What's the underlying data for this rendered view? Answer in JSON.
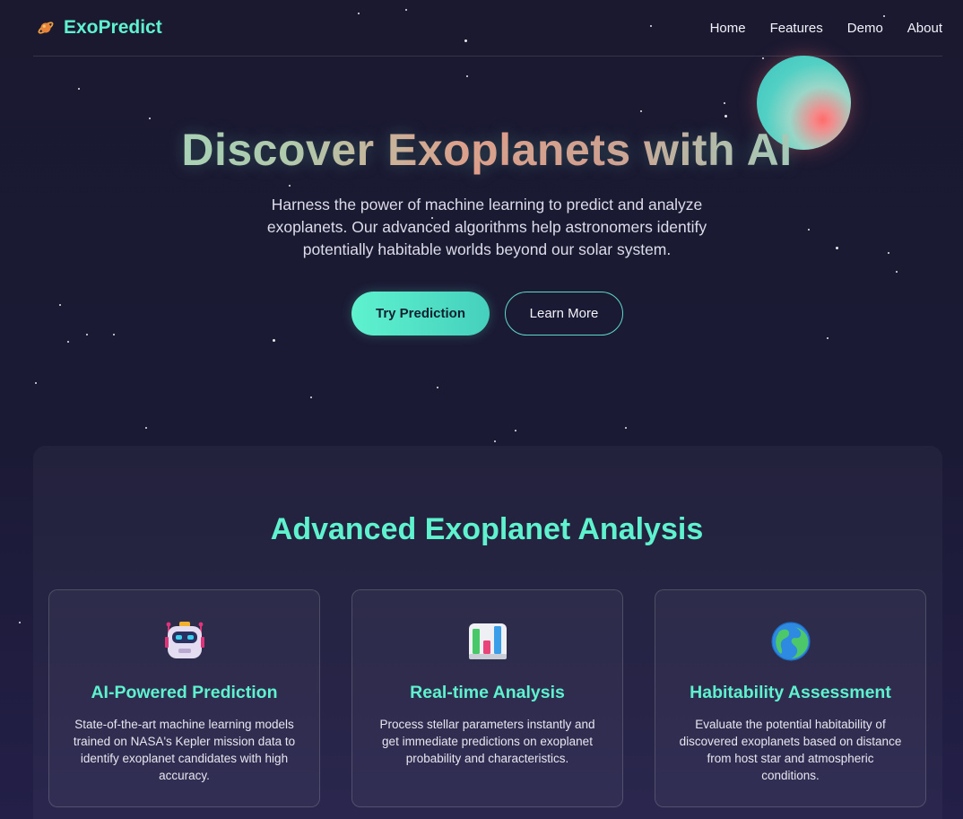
{
  "nav": {
    "brand": "ExoPredict",
    "brand_icon": "planet-rocket-icon",
    "links": [
      "Home",
      "Features",
      "Demo",
      "About"
    ]
  },
  "hero": {
    "title": "Discover Exoplanets with AI",
    "subtitle": "Harness the power of machine learning to predict and analyze exoplanets. Our advanced algorithms help astronomers identify potentially habitable worlds beyond our solar system.",
    "primary_button": "Try Prediction",
    "secondary_button": "Learn More"
  },
  "features": {
    "title": "Advanced Exoplanet Analysis",
    "cards": [
      {
        "icon": "robot-icon",
        "title": "AI-Powered Prediction",
        "text": "State-of-the-art machine learning models trained on NASA's Kepler mission data to identify exoplanet candidates with high accuracy."
      },
      {
        "icon": "bar-chart-icon",
        "title": "Real-time Analysis",
        "text": "Process stellar parameters instantly and get immediate predictions on exoplanet probability and characteristics."
      },
      {
        "icon": "globe-icon",
        "title": "Habitability Assessment",
        "text": "Evaluate the potential habitability of discovered exoplanets based on distance from host star and atmospheric conditions."
      }
    ]
  },
  "colors": {
    "accent": "#5ef2cf",
    "background": "#1a1930",
    "planet_glow": "#ff6b6b"
  }
}
